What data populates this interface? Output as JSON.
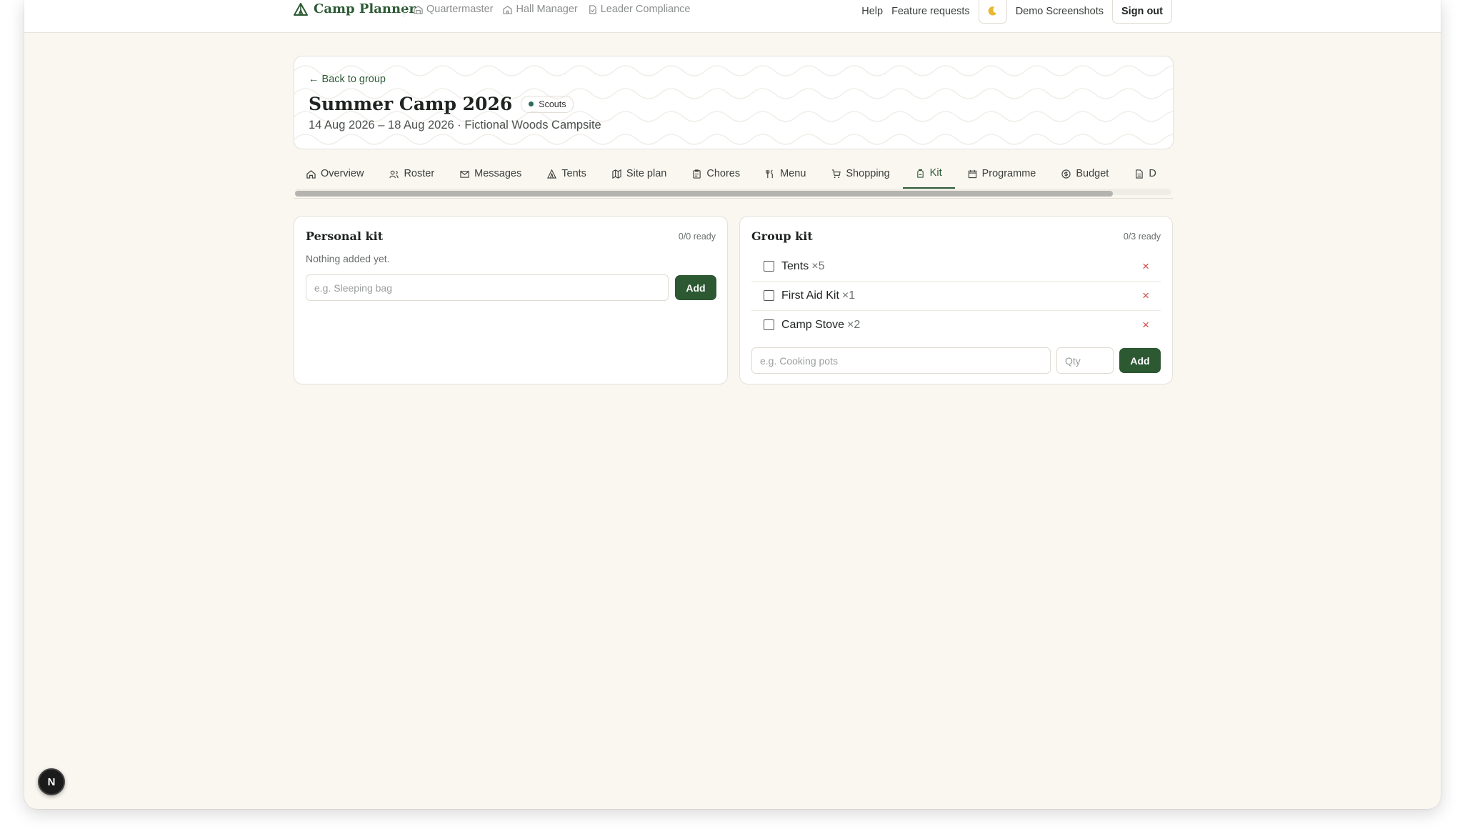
{
  "topbar": {
    "app_name": "Camp Planner",
    "nav_links": [
      "Quartermaster",
      "Hall Manager",
      "Leader Compliance"
    ],
    "help": "Help",
    "feature_requests": "Feature requests",
    "theme_icon": "moon-icon",
    "user": "Demo Screenshots",
    "sign_out": "Sign out"
  },
  "event": {
    "back": "← Back to group",
    "title": "Summer Camp 2026",
    "badge": "Scouts",
    "subtitle": "14 Aug 2026 – 18 Aug 2026 · Fictional Woods Campsite"
  },
  "tabs": [
    {
      "label": "Overview",
      "icon": "home-icon"
    },
    {
      "label": "Roster",
      "icon": "users-icon"
    },
    {
      "label": "Messages",
      "icon": "mail-icon"
    },
    {
      "label": "Tents",
      "icon": "tent-icon"
    },
    {
      "label": "Site plan",
      "icon": "map-icon"
    },
    {
      "label": "Chores",
      "icon": "clipboard-icon"
    },
    {
      "label": "Menu",
      "icon": "utensils-icon"
    },
    {
      "label": "Shopping",
      "icon": "cart-icon"
    },
    {
      "label": "Kit",
      "icon": "backpack-icon",
      "active": true
    },
    {
      "label": "Programme",
      "icon": "calendar-icon"
    },
    {
      "label": "Budget",
      "icon": "coin-icon"
    },
    {
      "label": "D",
      "icon": "document-icon"
    }
  ],
  "personal_kit": {
    "title": "Personal kit",
    "count": "0/0 ready",
    "empty": "Nothing added yet.",
    "placeholder": "e.g. Sleeping bag",
    "add": "Add"
  },
  "group_kit": {
    "title": "Group kit",
    "count": "0/3 ready",
    "items": [
      {
        "name": "Tents",
        "qty": "×5"
      },
      {
        "name": "First Aid Kit",
        "qty": "×1"
      },
      {
        "name": "Camp Stove",
        "qty": "×2"
      }
    ],
    "remove": "×",
    "placeholder": "e.g. Cooking pots",
    "qty_placeholder": "Qty",
    "add": "Add"
  },
  "dev_badge": "N",
  "colors": {
    "accent": "#2c5832",
    "background": "#faf6f0",
    "danger": "#d64545"
  }
}
